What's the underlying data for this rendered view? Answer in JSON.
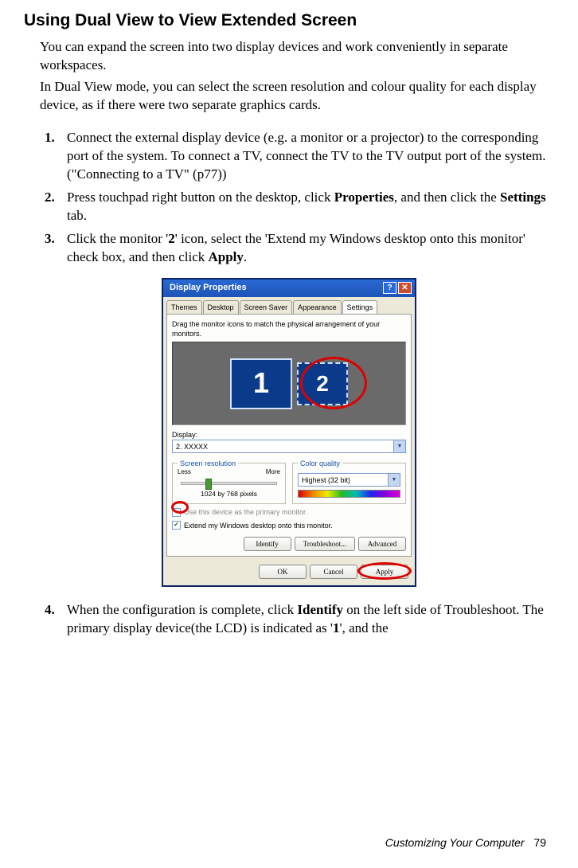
{
  "title": "Using Dual View to View Extended Screen",
  "intro": {
    "p1": "You can expand the screen into two display devices and work conveniently in separate workspaces.",
    "p2": "In Dual View mode, you can select the screen resolution and colour quality for each display device, as if there were two separate graphics cards."
  },
  "steps": {
    "s1": {
      "num": "1.",
      "text": "Connect the external display device (e.g. a monitor or a projector) to the corresponding port of the system. To connect a TV, connect the TV to the TV output port of the system.(\"Connecting to a TV\" (p77))"
    },
    "s2": {
      "num": "2.",
      "pre": "Press touchpad right button on the desktop, click ",
      "b1": "Properties",
      "mid": ", and then click the ",
      "b2": "Settings",
      "post": " tab."
    },
    "s3": {
      "num": "3.",
      "pre": "Click the monitor '",
      "b1": "2",
      "mid": "' icon, select the 'Extend my Windows desktop onto this monitor' check box, and then click ",
      "b2": "Apply",
      "post": "."
    },
    "s4": {
      "num": "4.",
      "pre": "When the configuration is complete, click ",
      "b1": "Identify",
      "mid": " on the left side of Troubleshoot. The primary display device(the LCD) is indicated as '",
      "b2": "1",
      "post": "', and the"
    }
  },
  "dialog": {
    "title": "Display Properties",
    "tabs": {
      "t1": "Themes",
      "t2": "Desktop",
      "t3": "Screen Saver",
      "t4": "Appearance",
      "t5": "Settings"
    },
    "hint": "Drag the monitor icons to match the physical arrangement of your monitors.",
    "mon1": "1",
    "mon2": "2",
    "display_label": "Display:",
    "display_value": "2. XXXXX",
    "res_legend": "Screen resolution",
    "less": "Less",
    "more": "More",
    "res_value": "1024 by 768 pixels",
    "cq_legend": "Color quality",
    "cq_value": "Highest (32 bit)",
    "cb1": "Use this device as the primary monitor.",
    "cb2": "Extend my Windows desktop onto this monitor.",
    "btn_identify": "Identify",
    "btn_trouble": "Troubleshoot...",
    "btn_advanced": "Advanced",
    "btn_ok": "OK",
    "btn_cancel": "Cancel",
    "btn_apply": "Apply"
  },
  "footer": {
    "section": "Customizing Your Computer",
    "page": "79"
  }
}
